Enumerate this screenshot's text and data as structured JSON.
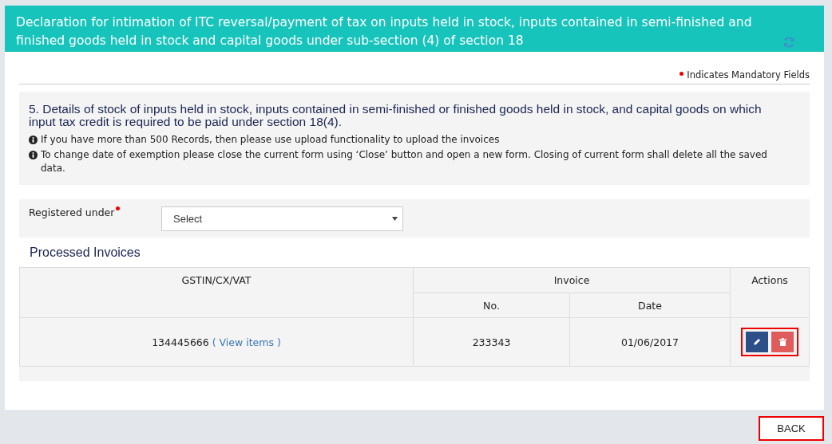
{
  "header": {
    "title": "Declaration for intimation of ITC reversal/payment of tax on inputs held in stock, inputs contained in semi-finished and finished goods held in stock and capital goods under sub-section (4) of section 18"
  },
  "mandatory_note": "Indicates Mandatory Fields",
  "section": {
    "heading": "5. Details of stock of inputs held in stock, inputs contained in semi-finished or finished goods held in stock, and capital goods on which input tax credit is required to be paid under section 18(4).",
    "notes": [
      "If you have more than 500 Records, then please use upload functionality to upload the invoices",
      "To change date of exemption please close the current form using ‘Close’ button and open a new form. Closing of current form shall delete all the saved data."
    ]
  },
  "registered_under": {
    "label": "Registered under",
    "required": true,
    "value": "Select"
  },
  "invoices": {
    "title": "Processed Invoices",
    "columns": {
      "gstin": "GSTIN/CX/VAT",
      "invoice": "Invoice",
      "no": "No.",
      "date": "Date",
      "actions": "Actions"
    },
    "rows": [
      {
        "gstin": "134445666",
        "link": "( View items )",
        "no": "233343",
        "date": "01/06/2017",
        "highlighted": true
      }
    ]
  },
  "back": {
    "label": "BACK",
    "highlighted": true
  }
}
